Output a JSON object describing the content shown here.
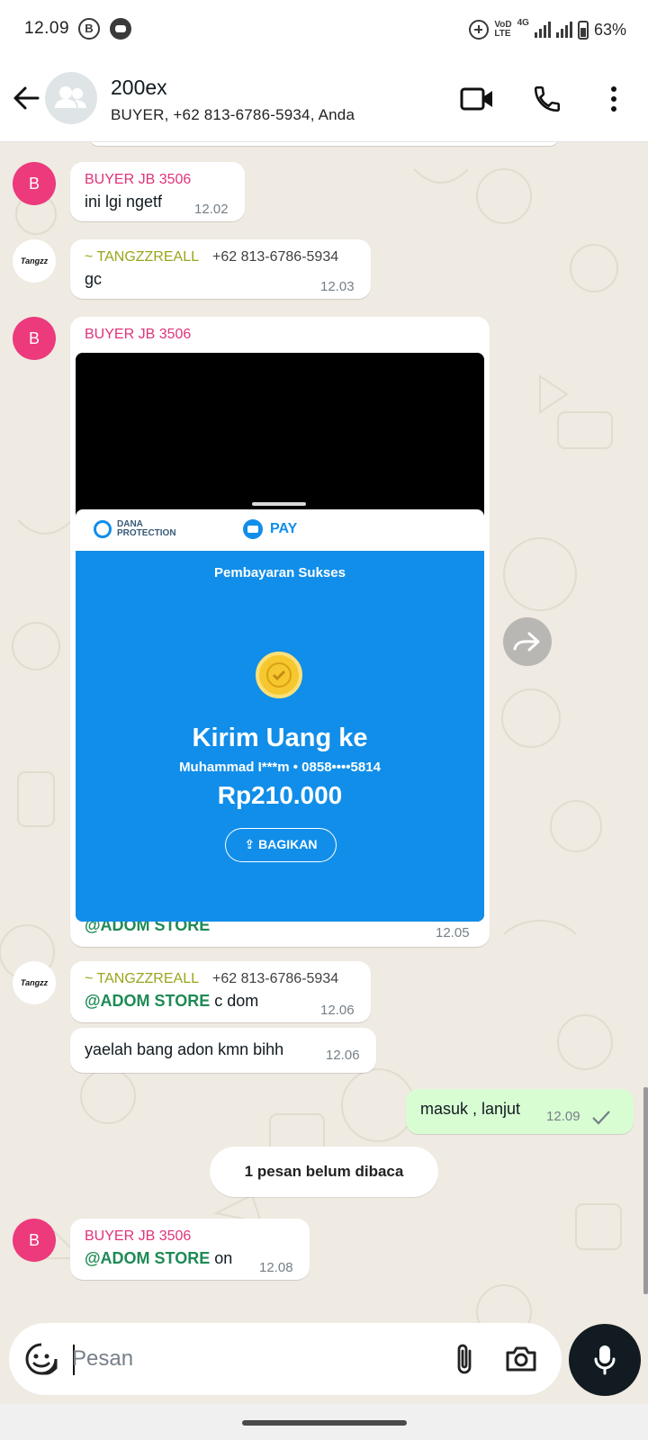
{
  "status_bar": {
    "time": "12.09",
    "b_icon": "B",
    "volte_top": "VoD",
    "volte_bottom": "LTE",
    "network": "4G",
    "battery": "63%"
  },
  "header": {
    "title": "200ex",
    "subtitle": "BUYER, +62 813-6786-5934, Anda"
  },
  "messages": [
    {
      "sender": "BUYER JB 3506",
      "text": "ini lgi ngetf",
      "time": "12.02"
    },
    {
      "sender": "~ TANGZZREALL",
      "phone": "+62 813-6786-5934",
      "text": "gc",
      "time": "12.03"
    },
    {
      "sender": "BUYER JB 3506",
      "caption_mention": "@ADOM STORE",
      "time": "12.05"
    },
    {
      "sender": "~ TANGZZREALL",
      "phone": "+62 813-6786-5934",
      "mention": "@ADOM STORE",
      "text": " c dom",
      "time": "12.06"
    },
    {
      "text": "yaelah bang adon kmn bihh",
      "time": "12.06"
    },
    {
      "text": "masuk , lanjut",
      "time": "12.09",
      "outgoing": true
    },
    {
      "sender": "BUYER JB 3506",
      "mention": "@ADOM STORE",
      "text": " on",
      "time": "12.08"
    }
  ],
  "avatars": {
    "buyer_initial": "B",
    "tangzz_logo": "Tangzz"
  },
  "receipt": {
    "dana_line1": "DANA",
    "dana_line2": "PROTECTION",
    "pay_label": "PAY",
    "status": "Pembayaran Sukses",
    "title": "Kirim Uang ke",
    "recipient": "Muhammad I***m • 0858••••5814",
    "amount": "Rp210.000",
    "share_label": "BAGIKAN"
  },
  "unread_banner": "1 pesan belum dibaca",
  "input": {
    "placeholder": "Pesan"
  },
  "colors": {
    "buyer_name": "#e0337a",
    "tangzz_name": "#9aa51c",
    "mention": "#1e8a55",
    "outgoing_bubble": "#d9fdd3",
    "receipt_blue": "#118ee9"
  }
}
